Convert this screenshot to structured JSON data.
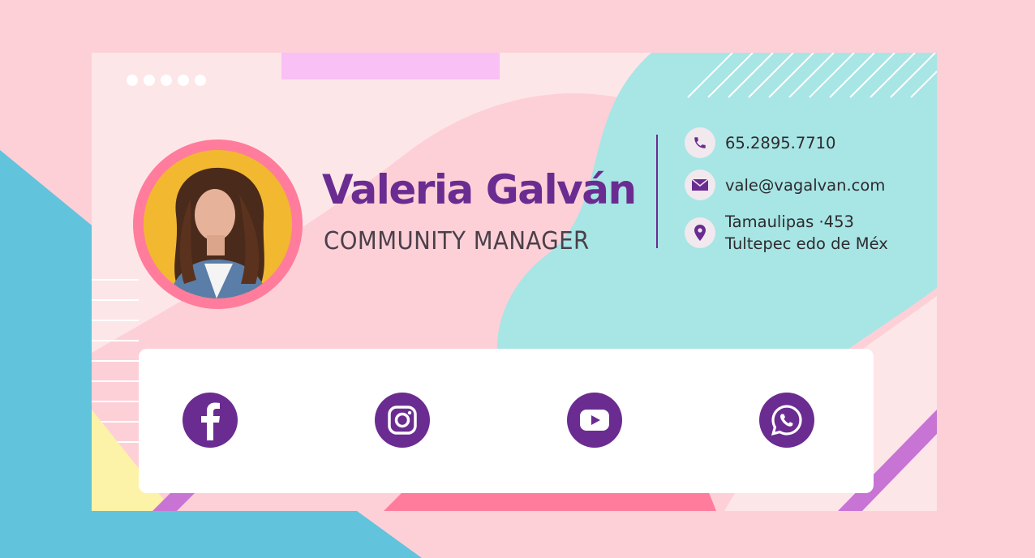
{
  "profile": {
    "name": "Valeria Galván",
    "role": "COMMUNITY MANAGER",
    "photo": "portrait-photo"
  },
  "contact": {
    "phone": "65.2895.7710",
    "email": "vale@vagalvan.com",
    "address_line1": "Tamaulipas ·453",
    "address_line2": "Tultepec edo de Méx"
  },
  "icons": {
    "phone": "phone-icon",
    "email": "envelope-icon",
    "address": "location-pin-icon"
  },
  "social": [
    "facebook",
    "instagram",
    "youtube",
    "whatsapp"
  ],
  "colors": {
    "accent": "#6a2c91",
    "pink": "#fdd0d7",
    "ring": "#ff7c9c",
    "teal": "#a8e5e5",
    "blue": "#62c3dc",
    "lavender": "#f8c0f5"
  }
}
